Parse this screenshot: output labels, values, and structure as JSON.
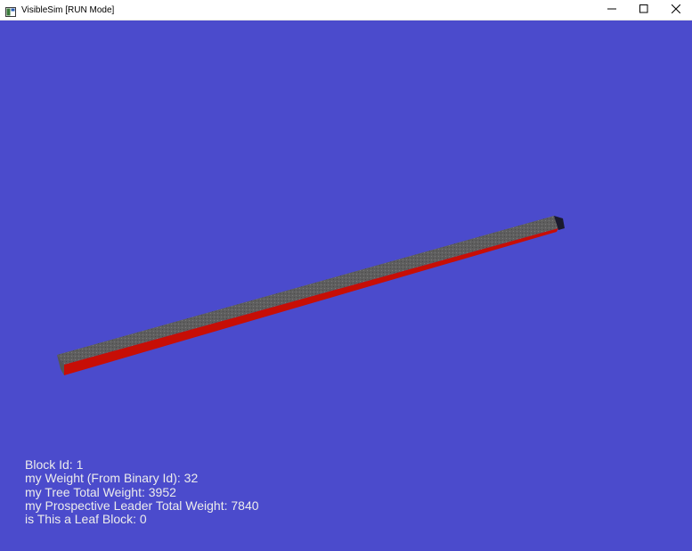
{
  "window": {
    "title": "VisibleSim [RUN Mode]",
    "icon": "app-window-icon",
    "controls": [
      "minimize-icon",
      "maximize-icon",
      "close-icon"
    ]
  },
  "viewport": {
    "background": "#4b4bcc",
    "block_colors": {
      "top": "#5f5f5f",
      "side": "#c70e06",
      "end_cap": "#1a1a2e"
    }
  },
  "info": {
    "block_id": "Block Id: 1",
    "weight": "my Weight (From Binary Id): 32",
    "tree_total": "my Tree Total Weight: 3952",
    "leader_total": "my Prospective Leader Total Weight: 7840",
    "leaf": "is This a Leaf Block: 0"
  }
}
